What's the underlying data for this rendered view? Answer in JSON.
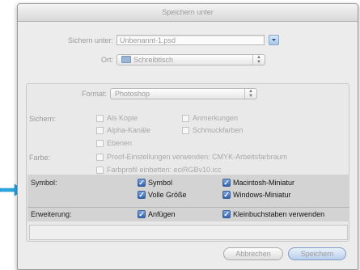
{
  "dialog": {
    "title": "Speichern unter",
    "save_as_label": "Sichern unter:",
    "filename": "Unbenannt-1.psd",
    "location_label": "Ort:",
    "location_value": "Schreibtisch"
  },
  "format": {
    "label": "Format:",
    "value": "Photoshop"
  },
  "save_options": {
    "label": "Sichern:",
    "items": [
      "Als Kopie",
      "Anmerkungen",
      "Alpha-Kanäle",
      "Schmuckfarben",
      "Ebenen"
    ]
  },
  "color": {
    "label": "Farbe:",
    "proof": "Proof-Einstellungen verwenden: CMYK-Arbeitsfarbraum",
    "profile": "Farbprofil einbetten: eciRGBv10.icc"
  },
  "symbol": {
    "label": "Symbol:",
    "items": [
      "Symbol",
      "Macintosh-Miniatur",
      "Volle Größe",
      "Windows-Miniatur"
    ]
  },
  "extension": {
    "label": "Erweiterung:",
    "append": "Anfügen",
    "lowercase": "Kleinbuchstaben verwenden"
  },
  "buttons": {
    "cancel": "Abbrechen",
    "save": "Speichern"
  },
  "checkmark": "✓",
  "colors": {
    "arrow": "#2aa6e0",
    "checkbox_blue": "#2f62b3",
    "highlight": "#d3d3d3"
  }
}
